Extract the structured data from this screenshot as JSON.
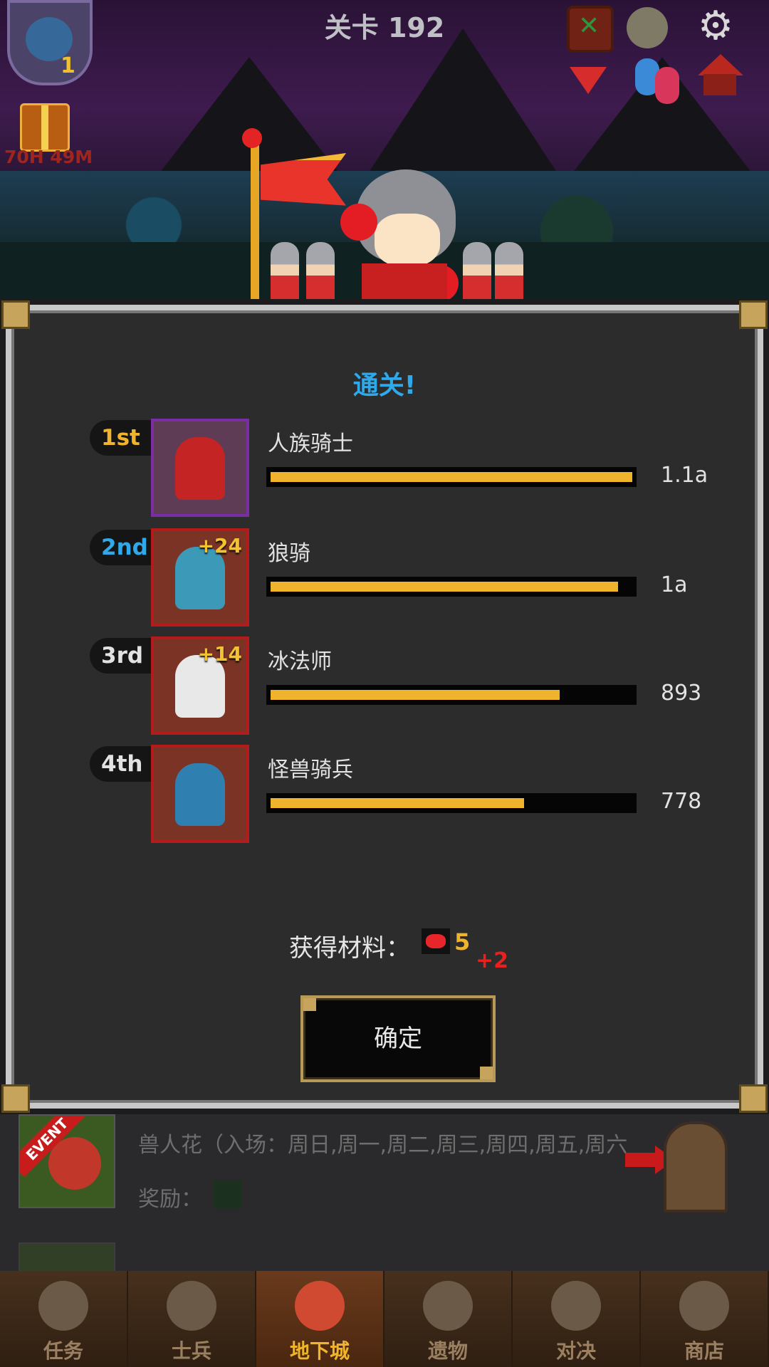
{
  "hud": {
    "level_title": "关卡 192",
    "boss_count": "1",
    "gift_timer": "70H 49M"
  },
  "modal": {
    "title": "通关!",
    "ranking": [
      {
        "rank": "1st",
        "rank_color": "#f0b42c",
        "name": "人族骑士",
        "bonus": "",
        "value": "1.1a",
        "fill_fraction": 1.0,
        "frame": "purple"
      },
      {
        "rank": "2nd",
        "rank_color": "#2fa9ea",
        "name": "狼骑",
        "bonus": "+24",
        "value": "1a",
        "fill_fraction": 0.96,
        "frame": "red"
      },
      {
        "rank": "3rd",
        "rank_color": "#e2e2e2",
        "name": "冰法师",
        "bonus": "+14",
        "value": "893",
        "fill_fraction": 0.8,
        "frame": "red"
      },
      {
        "rank": "4th",
        "rank_color": "#e2e2e2",
        "name": "怪兽骑兵",
        "bonus": "",
        "value": "778",
        "fill_fraction": 0.7,
        "frame": "red"
      }
    ],
    "reward_label": "获得材料：",
    "reward_count": "5",
    "reward_bonus": "+2",
    "confirm_label": "确定"
  },
  "dungeons": [
    {
      "badge": "EVENT",
      "title": "兽人花（入场：周日,周一,周二,周三,周四,周五,周六",
      "reward_label": "奖励："
    }
  ],
  "nav": [
    {
      "label": "任务",
      "active": false
    },
    {
      "label": "士兵",
      "active": false
    },
    {
      "label": "地下城",
      "active": true
    },
    {
      "label": "遗物",
      "active": false
    },
    {
      "label": "对决",
      "active": false
    },
    {
      "label": "商店",
      "active": false
    }
  ],
  "colors": {
    "accent_gold": "#f0b42c",
    "title_blue": "#2fa9ea",
    "bonus_red": "#e8201e"
  }
}
